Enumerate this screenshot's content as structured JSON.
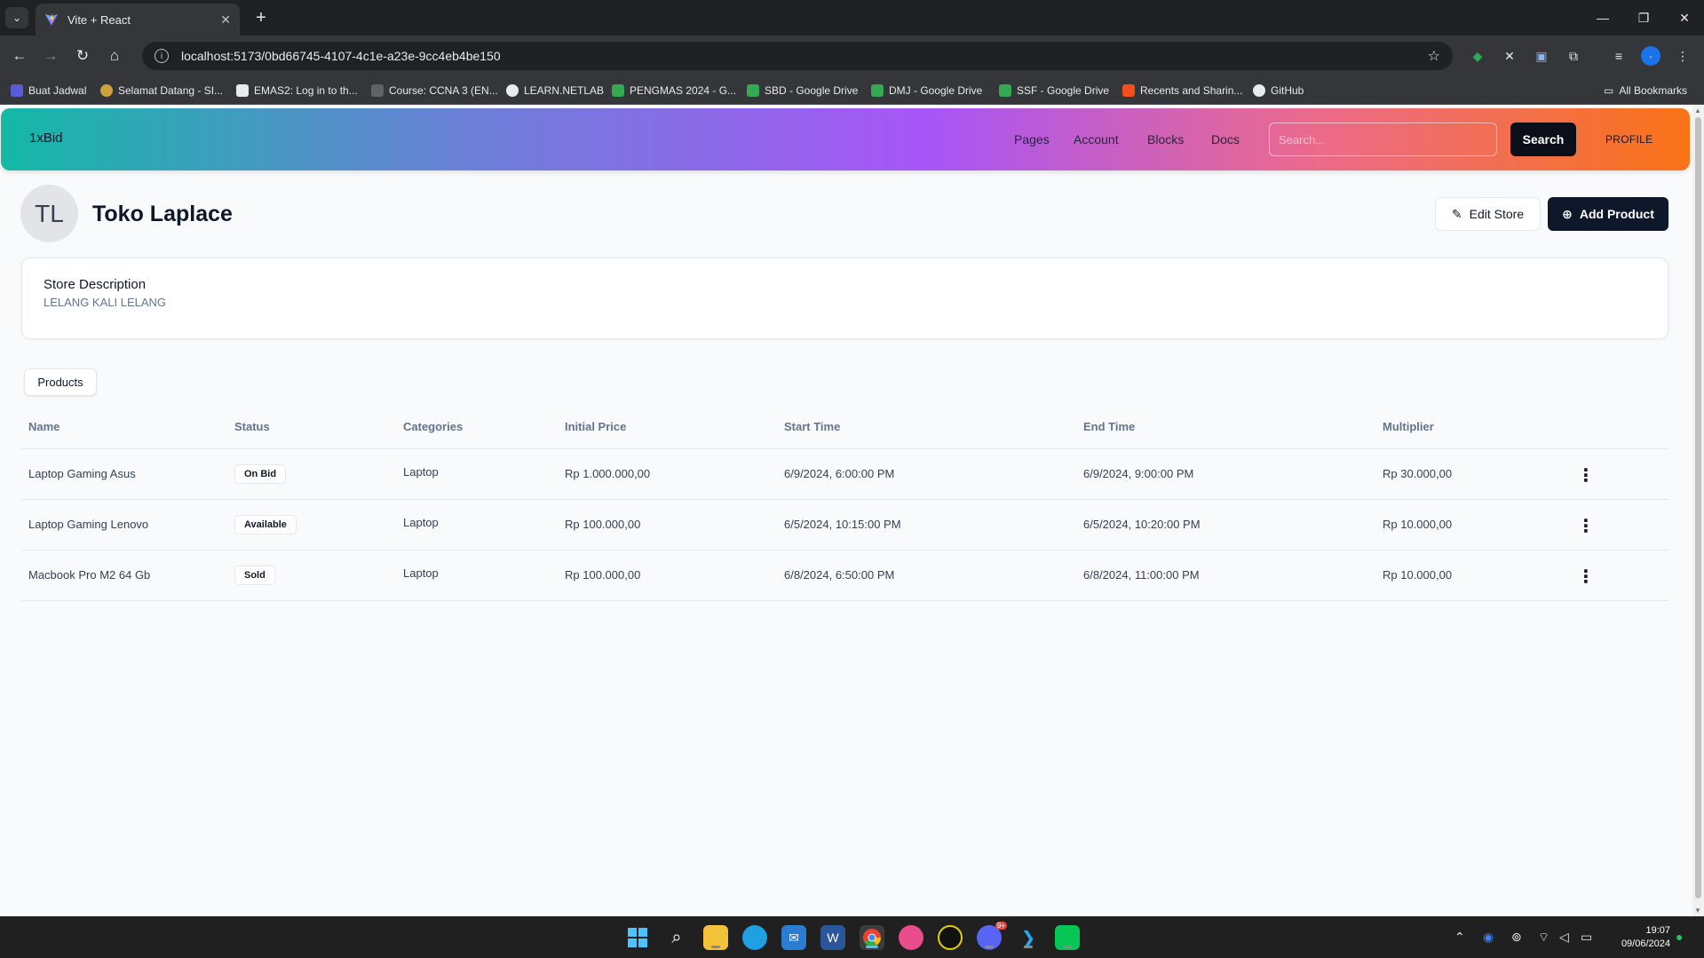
{
  "browser": {
    "tab_title": "Vite + React",
    "new_tab_symbol": "+",
    "url": "localhost:5173/0bd66745-4107-4c1e-a23e-9cc4eb4be150",
    "bookmarks": [
      {
        "label": "Buat Jadwal",
        "color": "#5b5bd6"
      },
      {
        "label": "Selamat Datang - SI...",
        "color": "#caa33b"
      },
      {
        "label": "EMAS2: Log in to th...",
        "color": "#e8eaed"
      },
      {
        "label": "Course: CCNA 3 (EN...",
        "color": "#5f6368"
      },
      {
        "label": "LEARN.NETLAB",
        "color": "#e8eaed"
      },
      {
        "label": "PENGMAS 2024 - G...",
        "color": "#34a853"
      },
      {
        "label": "SBD - Google Drive",
        "color": "#34a853"
      },
      {
        "label": "DMJ - Google Drive",
        "color": "#34a853"
      },
      {
        "label": "SSF - Google Drive",
        "color": "#34a853"
      },
      {
        "label": "Recents and Sharin...",
        "color": "#f24e1e"
      },
      {
        "label": "GitHub",
        "color": "#e8eaed"
      }
    ],
    "all_bookmarks": "All Bookmarks"
  },
  "nav": {
    "brand": "1xBid",
    "links": [
      "Pages",
      "Account",
      "Blocks",
      "Docs"
    ],
    "search_placeholder": "Search...",
    "search_button": "Search",
    "profile": "PROFILE"
  },
  "store": {
    "initials": "TL",
    "name": "Toko Laplace",
    "edit_label": "Edit Store",
    "add_label": "Add Product",
    "description_title": "Store Description",
    "description": "LELANG KALI LELANG"
  },
  "tabs": {
    "products": "Products"
  },
  "table": {
    "headers": [
      "Name",
      "Status",
      "Categories",
      "Initial Price",
      "Start Time",
      "End Time",
      "Multiplier"
    ],
    "rows": [
      {
        "name": "Laptop Gaming Asus",
        "status": "On Bid",
        "category": "Laptop",
        "initial_price": "Rp 1.000.000,00",
        "start": "6/9/2024, 6:00:00 PM",
        "end": "6/9/2024, 9:00:00 PM",
        "multiplier": "Rp 30.000,00"
      },
      {
        "name": "Laptop Gaming Lenovo",
        "status": "Available",
        "category": "Laptop",
        "initial_price": "Rp 100.000,00",
        "start": "6/5/2024, 10:15:00 PM",
        "end": "6/5/2024, 10:20:00 PM",
        "multiplier": "Rp 10.000,00"
      },
      {
        "name": "Macbook Pro M2 64 Gb",
        "status": "Sold",
        "category": "Laptop",
        "initial_price": "Rp 100.000,00",
        "start": "6/8/2024, 6:50:00 PM",
        "end": "6/8/2024, 11:00:00 PM",
        "multiplier": "Rp 10.000,00"
      }
    ]
  },
  "taskbar": {
    "time": "19:07",
    "date": "09/06/2024",
    "discord_badge": "9+"
  },
  "colors": {
    "accent_dark": "#0f172a",
    "gradient": [
      "#14b8a6",
      "#a855f7",
      "#f97316"
    ]
  }
}
